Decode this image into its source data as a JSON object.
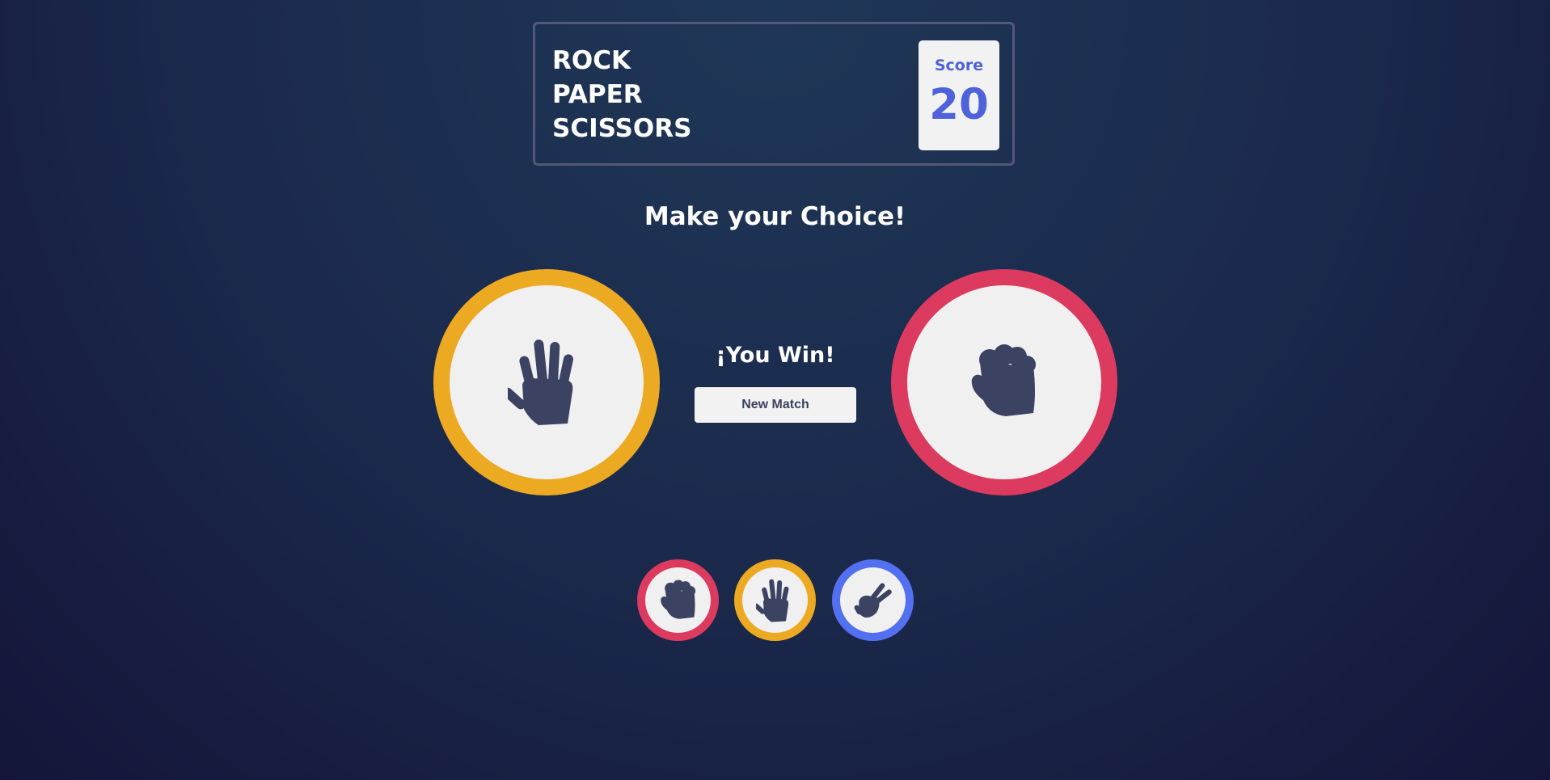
{
  "header": {
    "title_lines": [
      "ROCK",
      "PAPER",
      "SCISSORS"
    ],
    "score_label": "Score",
    "score_value": "20"
  },
  "prompt": "Make your Choice!",
  "match": {
    "player_choice": "paper",
    "house_choice": "rock",
    "result_text": "¡You Win!",
    "new_match_label": "New Match"
  },
  "choices": [
    {
      "id": "rock",
      "icon": "rock-hand-icon",
      "color": "#dc3a5e"
    },
    {
      "id": "paper",
      "icon": "paper-hand-icon",
      "color": "#eca922"
    },
    {
      "id": "scissors",
      "icon": "scissors-hand-icon",
      "color": "#5270f0"
    }
  ],
  "colors": {
    "background": "#1b2a4c",
    "paper": "#eca922",
    "rock": "#dc3a5e",
    "scissors": "#5270f0",
    "score": "#4f62d9",
    "icon": "#3b4262"
  }
}
